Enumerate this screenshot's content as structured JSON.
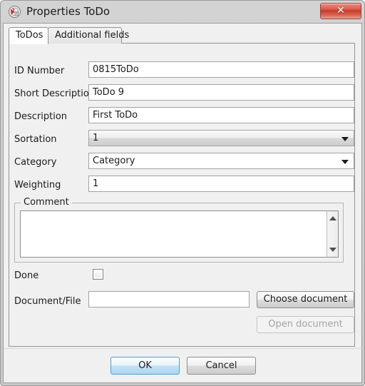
{
  "window": {
    "title": "Properties ToDo",
    "icon": "todo-app-icon",
    "close_label": "✕"
  },
  "tabs": [
    {
      "label": "ToDos",
      "selected": true
    },
    {
      "label": "Additional fields",
      "selected": false
    }
  ],
  "form": {
    "fields": [
      {
        "label": "ID Number",
        "value": "0815ToDo",
        "type": "text"
      },
      {
        "label": "Short Description",
        "value": "ToDo 9",
        "type": "text"
      },
      {
        "label": "Description",
        "value": "First ToDo",
        "type": "text"
      },
      {
        "label": "Sortation",
        "value": "1",
        "type": "combo-gray"
      },
      {
        "label": "Category",
        "value": "Category",
        "type": "combo-white"
      },
      {
        "label": "Weighting",
        "value": "1",
        "type": "text"
      }
    ],
    "comment": {
      "legend": "Comment",
      "value": "",
      "scroll_up_icon": "scroll-up-arrow-icon",
      "scroll_down_icon": "scroll-down-arrow-icon"
    },
    "done": {
      "label": "Done",
      "checked": false
    },
    "document": {
      "label": "Document/File",
      "value": "",
      "choose_label": "Choose document",
      "open_label": "Open document",
      "open_enabled": false
    }
  },
  "footer": {
    "ok_label": "OK",
    "cancel_label": "Cancel"
  },
  "colors": {
    "dialog_background": "#f0f0f0",
    "titlebar": "#d0d0d0",
    "close_button": "#c53a2b",
    "default_button_border": "#4f9ccf",
    "field_border": "#a3a3a3"
  }
}
